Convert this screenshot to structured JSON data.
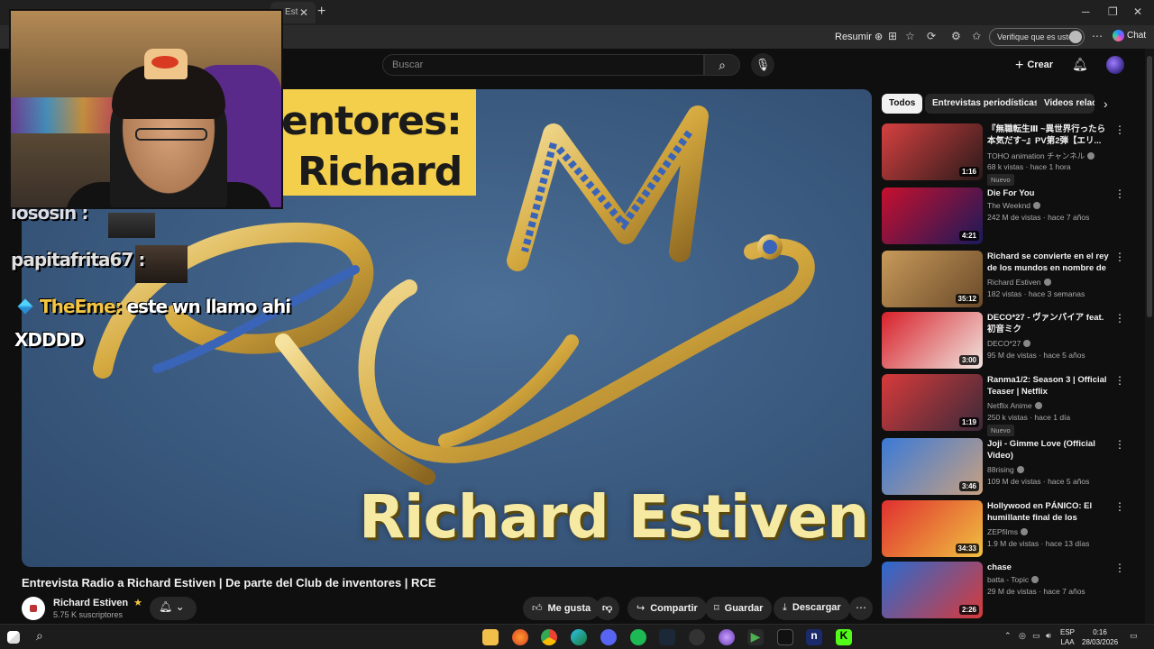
{
  "browser": {
    "tab_title": "Est",
    "resumir_label": "Resumir",
    "verify_label": "Verifique que es usted",
    "chat_label": "Chat"
  },
  "youtube": {
    "search_placeholder": "Buscar",
    "create_label": "Crear"
  },
  "video": {
    "overlay_top_line1": "entores:",
    "overlay_top_line2": "Richard",
    "overlay_bottom": "Richard Estiven",
    "title": "Entrevista Radio a Richard Estiven | De parte del Club de inventores | RCE"
  },
  "stream_chat": [
    {
      "user": "lososin :",
      "message": ""
    },
    {
      "user": "papitafrita67 :",
      "message": ""
    },
    {
      "user": "TheEme:",
      "message": "este wn llamo ahi"
    },
    {
      "user": "",
      "message": "XDDDD"
    }
  ],
  "channel": {
    "name": "Richard Estiven",
    "subscribers": "5.75 K suscriptores"
  },
  "actions": {
    "like": "Me gusta",
    "share": "Compartir",
    "save": "Guardar",
    "download": "Descargar"
  },
  "chips": [
    "Todos",
    "Entrevistas periodísticas",
    "Videos relac"
  ],
  "recommendations": [
    {
      "title": "『無職転生Ⅲ ~異世界行ったら本気だす~』PV第2弾【エリ...",
      "channel": "TOHO animation チャンネル",
      "meta": "68 k vistas · hace 1 hora",
      "badge": "Nuevo",
      "duration": "1:16",
      "colors": [
        "#d64040",
        "#2a1a1a"
      ]
    },
    {
      "title": "Die For You",
      "channel": "The Weeknd",
      "meta": "242 M de vistas · hace 7 años",
      "badge": "",
      "duration": "4:21",
      "colors": [
        "#c8102e",
        "#1a1a5a"
      ]
    },
    {
      "title": "Richard se convierte en el rey de los mundos en nombre de l...",
      "channel": "Richard Estiven",
      "meta": "182 vistas · hace 3 semanas",
      "badge": "",
      "duration": "35:12",
      "colors": [
        "#c89a5a",
        "#6a4a2a"
      ]
    },
    {
      "title": "DECO*27 - ヴァンパイア feat. 初音ミク",
      "channel": "DECO*27",
      "meta": "95 M de vistas · hace 5 años",
      "badge": "",
      "duration": "3:00",
      "colors": [
        "#d8202a",
        "#f0e6e0"
      ]
    },
    {
      "title": "Ranma1/2: Season 3 | Official Teaser | Netflix",
      "channel": "Netflix Anime",
      "meta": "250 k vistas · hace 1 día",
      "badge": "Nuevo",
      "duration": "1:19",
      "colors": [
        "#d83a3a",
        "#3a2a3a"
      ]
    },
    {
      "title": "Joji - Gimme Love (Official Video)",
      "channel": "88rising",
      "meta": "109 M de vistas · hace 5 años",
      "badge": "",
      "duration": "3:46",
      "colors": [
        "#3a7ad8",
        "#c8a080"
      ]
    },
    {
      "title": "Hollywood en PÁNICO: El humillante final de los premio...",
      "channel": "ZEPfilms",
      "meta": "1.9 M de vistas · hace 13 días",
      "badge": "",
      "duration": "34:33",
      "colors": [
        "#e03030",
        "#f0c040"
      ]
    },
    {
      "title": "chase",
      "channel": "batta - Topic",
      "meta": "29 M de vistas · hace 7 años",
      "badge": "",
      "duration": "2:26",
      "colors": [
        "#2a6ad0",
        "#d83a3a"
      ]
    }
  ],
  "taskbar": {
    "lang_line1": "ESP",
    "lang_line2": "LAA",
    "time": "0:16",
    "date": "28/03/2026"
  }
}
